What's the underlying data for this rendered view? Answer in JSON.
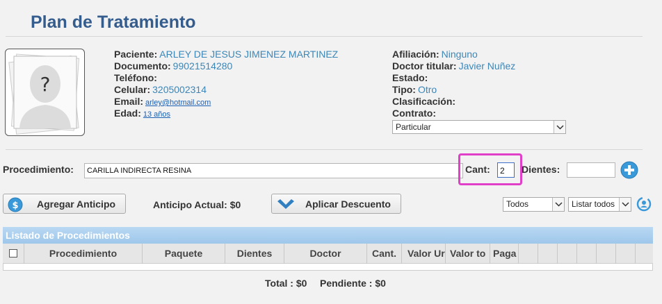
{
  "page": {
    "title": "Plan de Tratamiento"
  },
  "patient": {
    "left": [
      {
        "label": "Paciente:",
        "value": "ARLEY DE JESUS JIMENEZ MARTINEZ",
        "kind": "text"
      },
      {
        "label": "Documento:",
        "value": "99021514280",
        "kind": "text"
      },
      {
        "label": "Teléfono:",
        "value": "",
        "kind": "text"
      },
      {
        "label": "Celular:",
        "value": "3205002314",
        "kind": "text"
      },
      {
        "label": "Email:",
        "value": "arley@hotmail.com",
        "kind": "link"
      },
      {
        "label": "Edad:",
        "value": "13 años",
        "kind": "link"
      }
    ],
    "right": [
      {
        "label": "Afiliación:",
        "value": "Ninguno"
      },
      {
        "label": "Doctor titular:",
        "value": "Javier Nuñez"
      },
      {
        "label": "Estado:",
        "value": ""
      },
      {
        "label": "Tipo:",
        "value": "Otro"
      },
      {
        "label": "Clasificación:",
        "value": ""
      },
      {
        "label": "Contrato:",
        "value": ""
      }
    ],
    "contrato_select": "Particular",
    "photo_placeholder": "?"
  },
  "procedure": {
    "label": "Procedimiento:",
    "value": "CARILLA INDIRECTA RESINA",
    "cant_label": "Cant:",
    "cant_value": "2",
    "dientes_label": "Dientes:",
    "dientes_value": ""
  },
  "actions": {
    "anticipo_button": "Agregar Anticipo",
    "anticipo_actual": "Anticipo Actual: $0",
    "descuento_button": "Aplicar Descuento",
    "filter_select": "Todos",
    "list_select": "Listar todos"
  },
  "grid": {
    "title": "Listado de Procedimientos",
    "columns": [
      "Procedimiento",
      "Paquete",
      "Dientes",
      "Doctor",
      "Cant.",
      "Valor Ur",
      "Valor to",
      "Paga"
    ]
  },
  "totals": {
    "total": "Total : $0",
    "pendiente": "Pendiente : $0"
  },
  "colors": {
    "title": "#345c8c",
    "value": "#3c86b7",
    "highlight": "#e040c8",
    "grid_header": "#a8cdee"
  }
}
